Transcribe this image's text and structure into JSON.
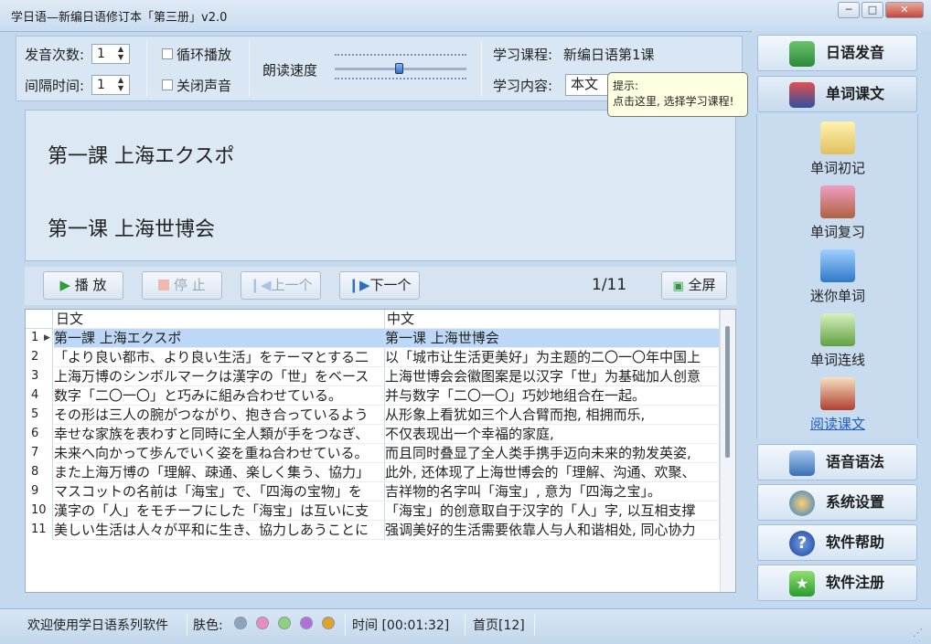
{
  "window": {
    "title": "学日语—新编日语修订本「第三册」v2.0",
    "min_label": "─",
    "max_label": "□",
    "close_label": "✕"
  },
  "controls": {
    "play_count_label": "发音次数:",
    "play_count_value": "1",
    "interval_label": "间隔时间:",
    "interval_value": "1",
    "loop_label": "循环播放",
    "mute_label": "关闭声音",
    "speed_label": "朗读速度",
    "speed_level": 0.38,
    "course_label": "学习课程:",
    "course_value": "新编日语第1课",
    "content_label": "学习内容:",
    "content_value": "本文"
  },
  "tooltip": {
    "title": "提示:",
    "text": "点击这里, 选择学习课程!"
  },
  "display": {
    "japanese": "第一課  上海エクスポ",
    "chinese": "第一课  上海世博会"
  },
  "toolbar": {
    "play": "播 放",
    "stop": "停 止",
    "prev": "上一个",
    "next": "下一个",
    "page": "1/11",
    "fullscreen": "全屏"
  },
  "grid": {
    "headers": [
      "日文",
      "中文"
    ],
    "rows": [
      {
        "n": "1",
        "jp": "第一課  上海エクスポ",
        "cn": "第一课  上海世博会"
      },
      {
        "n": "2",
        "jp": "「より良い都市、より良い生活」をテーマとする二",
        "cn": "以「城市让生活更美好」为主题的二〇一〇年中国上"
      },
      {
        "n": "3",
        "jp": "上海万博のシンボルマークは漢字の「世」をベース",
        "cn": "上海世博会会徽图案是以汉字「世」为基础加人创意"
      },
      {
        "n": "4",
        "jp": "数字「二〇一〇」と巧みに組み合わせている。",
        "cn": "并与数字「二〇一〇」巧妙地组合在一起。"
      },
      {
        "n": "5",
        "jp": "その形は三人の腕がつながり、抱き合っているよう",
        "cn": "从形象上看犹如三个人合臂而抱, 相拥而乐,"
      },
      {
        "n": "6",
        "jp": "幸せな家族を表わすと同時に全人類が手をつなぎ、",
        "cn": "不仅表现出一个幸福的家庭,"
      },
      {
        "n": "7",
        "jp": "未来へ向かって歩んでいく姿を重ね合わせている。",
        "cn": "而且同时叠显了全人类手携手迈向未来的勃发英姿,"
      },
      {
        "n": "8",
        "jp": "また上海万博の「理解、疎通、楽しく集う、協力」",
        "cn": "此外, 还体现了上海世博会的「理解、沟通、欢聚、"
      },
      {
        "n": "9",
        "jp": "マスコットの名前は「海宝」で、「四海の宝物」を",
        "cn": "吉祥物的名字叫「海宝」, 意为「四海之宝」。"
      },
      {
        "n": "10",
        "jp": "漢字の「人」をモチーフにした「海宝」は互いに支",
        "cn": "「海宝」的创意取自于汉字的「人」字, 以互相支撑"
      },
      {
        "n": "11",
        "jp": "美しい生活は人々が平和に生き、協力しあうことに",
        "cn": "强调美好的生活需要依靠人与人和谐相处, 同心协力"
      }
    ]
  },
  "sidebar": {
    "pronunciation": "日语发音",
    "words_text": "单词课文",
    "sub": [
      "单词初记",
      "单词复习",
      "迷你单词",
      "单词连线",
      "阅读课文"
    ],
    "grammar": "语音语法",
    "settings": "系统设置",
    "help": "软件帮助",
    "register": "软件注册"
  },
  "status": {
    "welcome": "欢迎使用学日语系列软件",
    "skin_label": "肤色:",
    "skins": [
      "#8ea4bd",
      "#e88cc2",
      "#8fd07a",
      "#b36fd6",
      "#e0a126"
    ],
    "time": "时间  [00:01:32]",
    "page": "首页[12]"
  },
  "colors": {
    "accent": "#c5d9ee",
    "selected_row": "#bcd8f6",
    "tooltip_bg": "#ffffe1"
  }
}
